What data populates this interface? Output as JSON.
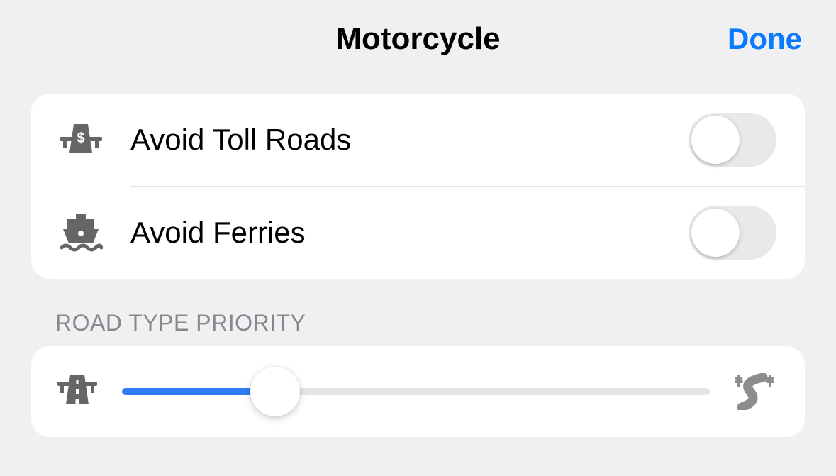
{
  "header": {
    "title": "Motorcycle",
    "done_label": "Done"
  },
  "options": {
    "toll": {
      "label": "Avoid Toll Roads",
      "value": false
    },
    "ferries": {
      "label": "Avoid Ferries",
      "value": false
    }
  },
  "section": {
    "road_type_priority": "ROAD TYPE PRIORITY"
  },
  "slider": {
    "value_percent": 26
  }
}
